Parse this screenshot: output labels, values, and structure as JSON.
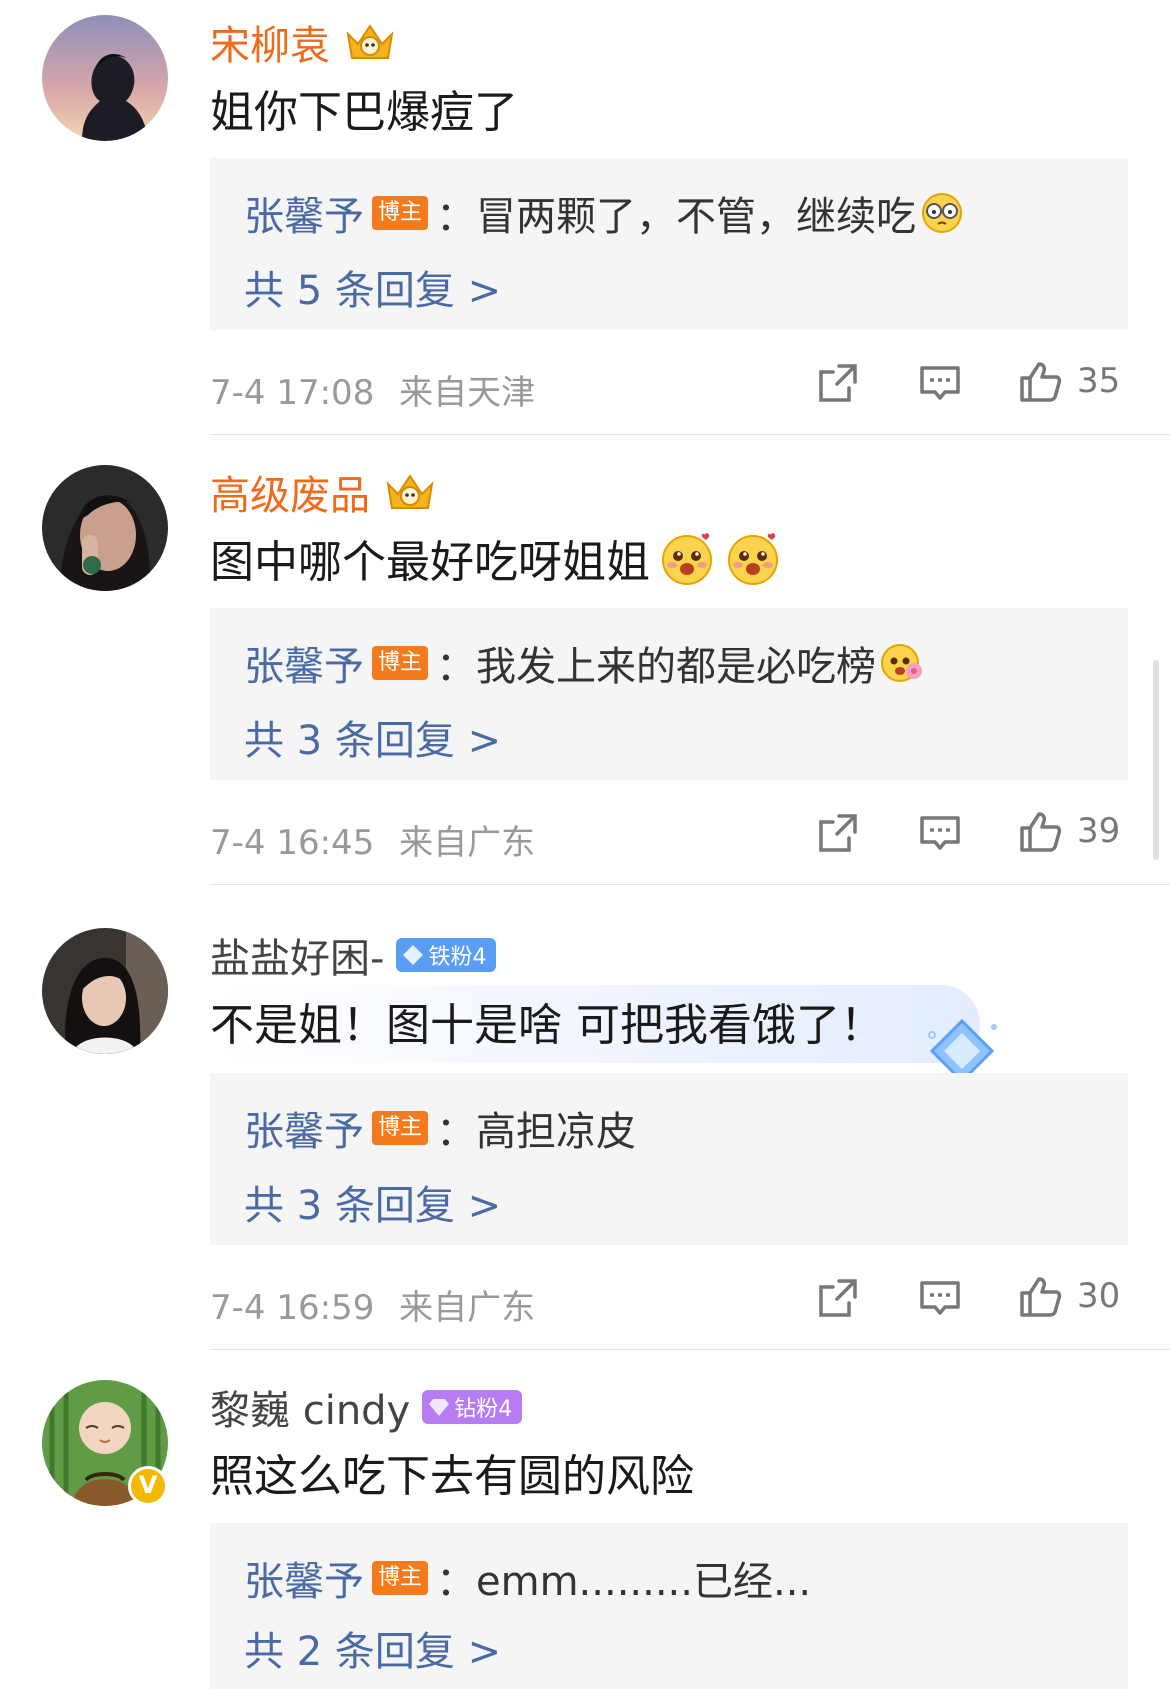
{
  "comments": [
    {
      "username": "宋柳袁",
      "text": "姐你下巴爆痘了",
      "reply": {
        "author": "张馨予",
        "badge": "博主",
        "text": "：冒两颗了，不管，继续吃",
        "more": "共 5 条回复 >"
      },
      "time": "7-4 17:08",
      "location": "来自天津",
      "likes": "35"
    },
    {
      "username": "高级废品",
      "text": "图中哪个最好吃呀姐姐",
      "reply": {
        "author": "张馨予",
        "badge": "博主",
        "text": "：我发上来的都是必吃榜",
        "more": "共 3 条回复 >"
      },
      "time": "7-4 16:45",
      "location": "来自广东",
      "likes": "39"
    },
    {
      "username": "盐盐好困-",
      "fan_badge": "铁粉4",
      "text": "不是姐！图十是啥 可把我看饿了！",
      "reply": {
        "author": "张馨予",
        "badge": "博主",
        "text": "：高担凉皮",
        "more": "共 3 条回复 >"
      },
      "time": "7-4 16:59",
      "location": "来自广东",
      "likes": "30"
    },
    {
      "username": "黎巍 cindy",
      "fan_badge": "钻粉4",
      "verified_mark": "V",
      "text": "照这么吃下去有圆的风险",
      "reply": {
        "author": "张馨予",
        "badge": "博主",
        "text": "：emm.........已经...",
        "more": "共 2 条回复 >"
      }
    }
  ],
  "colors": {
    "vip_name": "#f06a1c",
    "reply_link": "#4a6aa5",
    "host_badge": "#f37b1d",
    "iron_fan": "#5a9df5",
    "diamond_fan": "#b77cf2",
    "meta_gray": "#999999",
    "reply_bg": "#f5f5f5"
  },
  "icons": [
    "crown-icon",
    "grin-emoji",
    "blush-emoji",
    "love-emoji",
    "share-icon",
    "comment-icon",
    "like-icon",
    "gem-icon"
  ]
}
